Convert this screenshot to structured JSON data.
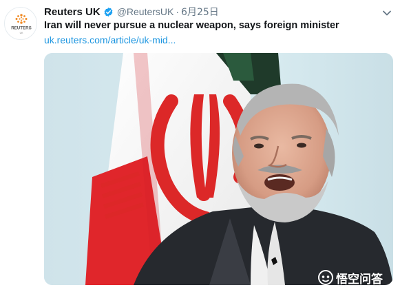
{
  "tweet": {
    "author": "Reuters UK",
    "handle": "@ReutersUK",
    "separator": "·",
    "date": "6月25日",
    "avatar_text": "REUTERS",
    "avatar_subtext": "UK",
    "headline": "Iran will never pursue a nuclear weapon, says foreign minister",
    "link": "uk.reuters.com/article/uk-mid..."
  },
  "watermark": {
    "text": "悟空问答"
  },
  "colors": {
    "link": "#1b95e0",
    "verified": "#1da1f2",
    "muted": "#657786",
    "brand_orange": "#f08a24"
  },
  "icons": {
    "verified": "verified-badge-icon",
    "menu": "chevron-down-icon",
    "watermark": "wukong-logo-icon"
  }
}
